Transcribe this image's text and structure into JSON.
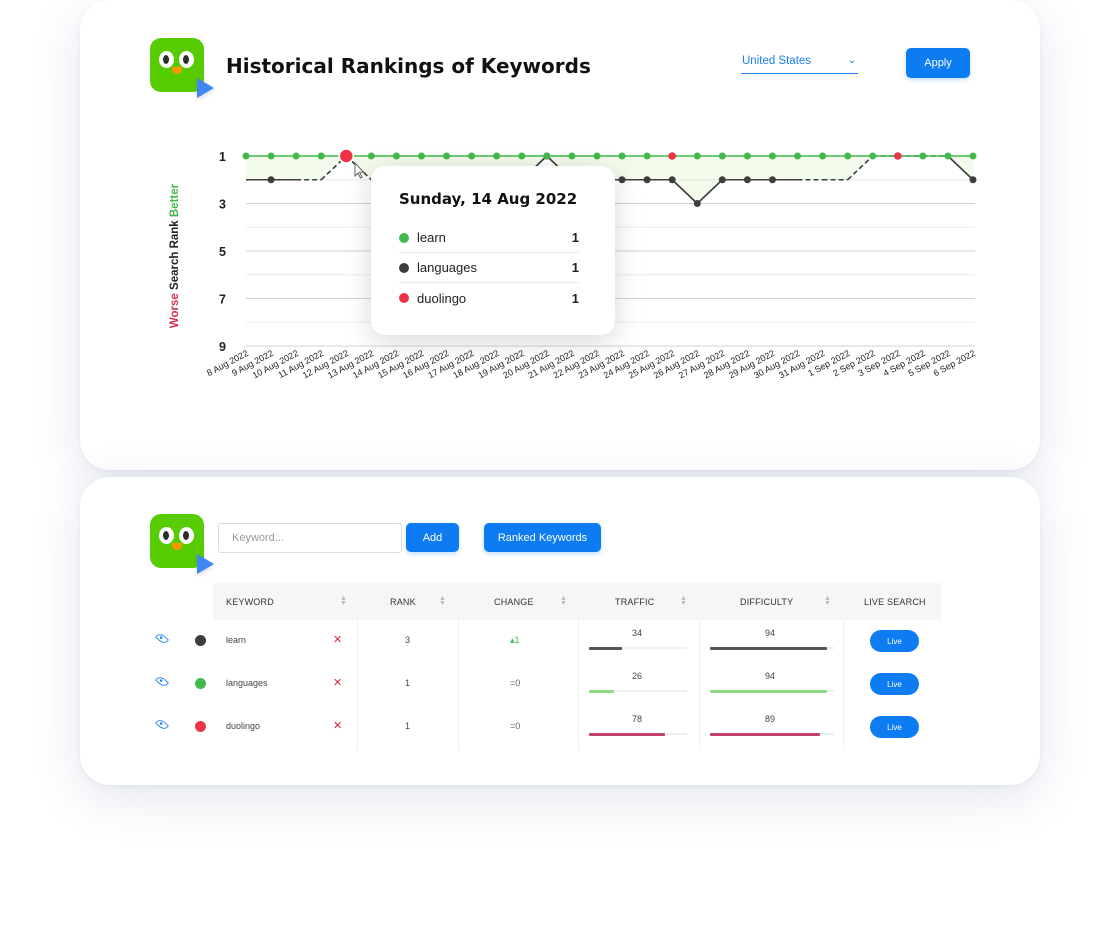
{
  "header": {
    "title": "Historical Rankings of Keywords",
    "country_select": "United States",
    "apply_label": "Apply"
  },
  "chart_data": {
    "type": "line",
    "ylabel_worse": "Worse",
    "ylabel_main": "Search Rank",
    "ylabel_better": "Better",
    "y_ticks": [
      "1",
      "3",
      "5",
      "7",
      "9"
    ],
    "ylim": [
      9,
      1
    ],
    "x": [
      "8 Aug 2022",
      "9 Aug 2022",
      "10 Aug 2022",
      "11 Aug 2022",
      "12 Aug 2022",
      "13 Aug 2022",
      "14 Aug 2022",
      "15 Aug 2022",
      "16 Aug 2022",
      "17 Aug 2022",
      "18 Aug 2022",
      "19 Aug 2022",
      "20 Aug 2022",
      "21 Aug 2022",
      "22 Aug 2022",
      "23 Aug 2022",
      "24 Aug 2022",
      "25 Aug 2022",
      "26 Aug 2022",
      "27 Aug 2022",
      "28 Aug 2022",
      "29 Aug 2022",
      "30 Aug 2022",
      "31 Aug 2022",
      "1 Sep 2022",
      "2 Sep 2022",
      "3 Sep 2022",
      "4 Sep 2022",
      "5 Sep 2022",
      "6 Sep 2022"
    ],
    "series": [
      {
        "name": "learn",
        "color": "#43b94b",
        "values": [
          1,
          1,
          1,
          1,
          1,
          1,
          1,
          1,
          1,
          1,
          1,
          1,
          1,
          1,
          1,
          1,
          1,
          1,
          1,
          1,
          1,
          1,
          1,
          1,
          1,
          1,
          1,
          1,
          1,
          1
        ]
      },
      {
        "name": "languages",
        "color": "#3d3d3d",
        "values": [
          2,
          2,
          2,
          2,
          1,
          2,
          2,
          2,
          2,
          2,
          2,
          2,
          1,
          2,
          2,
          2,
          2,
          2,
          3,
          2,
          2,
          2,
          2,
          2,
          2,
          1,
          1,
          1,
          1,
          2
        ]
      },
      {
        "name": "duolingo",
        "color": "#ef3346",
        "values": [
          null,
          null,
          null,
          null,
          1,
          null,
          null,
          null,
          null,
          null,
          null,
          null,
          null,
          null,
          null,
          null,
          null,
          1,
          null,
          null,
          null,
          null,
          null,
          null,
          null,
          null,
          1,
          null,
          null,
          null
        ]
      }
    ],
    "grid": true
  },
  "tooltip": {
    "date": "Sunday, 14 Aug 2022",
    "rows": [
      {
        "name": "learn",
        "value": "1",
        "color": "#43b94b"
      },
      {
        "name": "languages",
        "value": "1",
        "color": "#3d3d3d"
      },
      {
        "name": "duolingo",
        "value": "1",
        "color": "#ef3346"
      }
    ]
  },
  "toolbar": {
    "keyword_placeholder": "Keyword...",
    "add_label": "Add",
    "ranked_label": "Ranked Keywords"
  },
  "table": {
    "headers": [
      "KEYWORD",
      "RANK",
      "CHANGE",
      "TRAFFIC",
      "DIFFICULTY",
      "LIVE SEARCH"
    ],
    "rows": [
      {
        "keyword": "learn",
        "dot_color": "#3d3d3d",
        "rank": "3",
        "change": "▴1",
        "traffic": "34",
        "traffic_pct": 0.34,
        "traffic_color": "#555555",
        "difficulty": "94",
        "difficulty_pct": 0.94,
        "difficulty_color": "#555555",
        "live_label": "Live"
      },
      {
        "keyword": "languages",
        "dot_color": "#43b94b",
        "rank": "1",
        "change": "=0",
        "traffic": "26",
        "traffic_pct": 0.26,
        "traffic_color": "#8ddc84",
        "difficulty": "94",
        "difficulty_pct": 0.94,
        "difficulty_color": "#8ddc84",
        "live_label": "Live"
      },
      {
        "keyword": "duolingo",
        "dot_color": "#ef3346",
        "rank": "1",
        "change": "=0",
        "traffic": "78",
        "traffic_pct": 0.78,
        "traffic_color": "#c2406b",
        "difficulty": "89",
        "difficulty_pct": 0.89,
        "difficulty_color": "#c2406b",
        "live_label": "Live"
      }
    ]
  }
}
